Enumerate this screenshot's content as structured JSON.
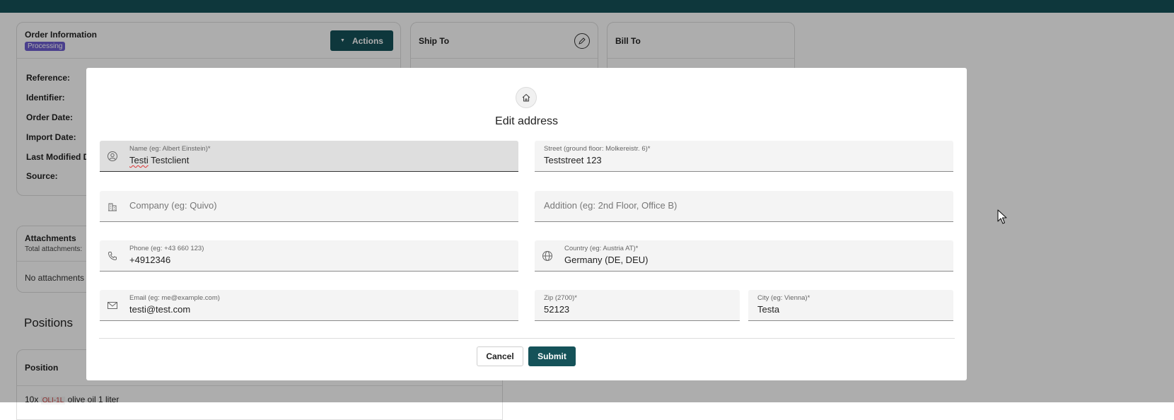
{
  "order_card": {
    "title": "Order Information",
    "status_badge": "Processing",
    "actions_label": "Actions",
    "fields": [
      "Reference:",
      "Identifier:",
      "Order Date:",
      "Import Date:",
      "Last Modified Da",
      "Source:"
    ]
  },
  "ship_to": {
    "title": "Ship To"
  },
  "bill_to": {
    "title": "Bill To"
  },
  "attachments": {
    "title": "Attachments",
    "subtitle": "Total attachments:",
    "empty_text": "No attachments fo"
  },
  "positions": {
    "title": "Positions",
    "column_header": "Position",
    "first_row": "10x",
    "first_row_sku": "OLI-1L",
    "first_row_name": "olive oil 1 liter"
  },
  "modal": {
    "title": "Edit address",
    "fields": {
      "name": {
        "label": "Name (eg: Albert Einstein)*",
        "value_first": "Testi",
        "value_rest": " Testclient"
      },
      "street": {
        "label": "Street (ground floor: Molkereistr. 6)*",
        "value": "Teststreet 123"
      },
      "company": {
        "placeholder": "Company (eg: Quivo)"
      },
      "addition": {
        "placeholder": "Addition (eg: 2nd Floor, Office B)"
      },
      "phone": {
        "label": "Phone (eg: +43 660 123)",
        "value": "+4912346"
      },
      "country": {
        "label": "Country (eg: Austria AT)*",
        "value": "Germany (DE, DEU)"
      },
      "email": {
        "label": "Email (eg: me@example.com)",
        "value": "testi@test.com"
      },
      "zip": {
        "label": "Zip (2700)*",
        "value": "52123"
      },
      "city": {
        "label": "City (eg: Vienna)*",
        "value": "Testa"
      }
    },
    "cancel_label": "Cancel",
    "submit_label": "Submit"
  },
  "icons": {
    "home": "home-icon",
    "person": "person-icon",
    "building": "building-icon",
    "phone": "phone-icon",
    "globe": "globe-icon",
    "mail": "mail-icon",
    "edit": "pencil-icon",
    "cursor": "mouse-cursor-icon"
  },
  "colors": {
    "brand": "#155259",
    "badge": "#6e5dd0"
  }
}
